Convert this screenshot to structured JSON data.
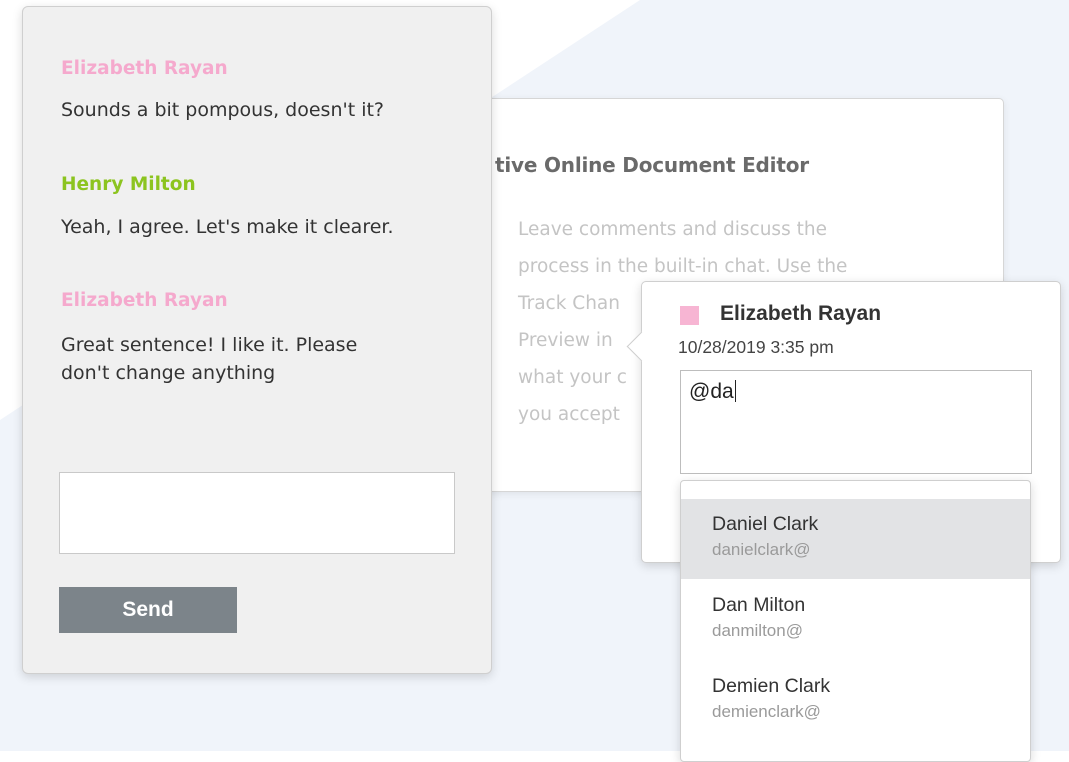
{
  "document": {
    "title": "tive Online Document Editor",
    "lines": [
      "Leave comments and discuss the",
      "process in the built-in chat. Use the",
      "Track Chan",
      "Preview in",
      "what your c",
      "you accept"
    ]
  },
  "chat": {
    "messages": [
      {
        "author": "Elizabeth Rayan",
        "text": "Sounds a bit pompous, doesn't it?"
      },
      {
        "author": "Henry Milton",
        "text": "Yeah, I agree. Let's make it clearer."
      },
      {
        "author": "Elizabeth Rayan",
        "text": "Great sentence! I like it. Please don't change anything"
      }
    ],
    "input_value": "",
    "send_label": "Send"
  },
  "comment": {
    "author": "Elizabeth Rayan",
    "date": "10/28/2019  3:35 pm",
    "text": "@da"
  },
  "mentions": [
    {
      "name": "Daniel Clark",
      "handle": "danielclark@"
    },
    {
      "name": "Dan Milton",
      "handle": "danmilton@"
    },
    {
      "name": "Demien Clark",
      "handle": "demienclark@"
    }
  ],
  "colors": {
    "elizabeth": "#f5a9cd",
    "henry": "#8cc41f",
    "send_button": "#7c848a",
    "selected_item": "#e2e3e5"
  }
}
